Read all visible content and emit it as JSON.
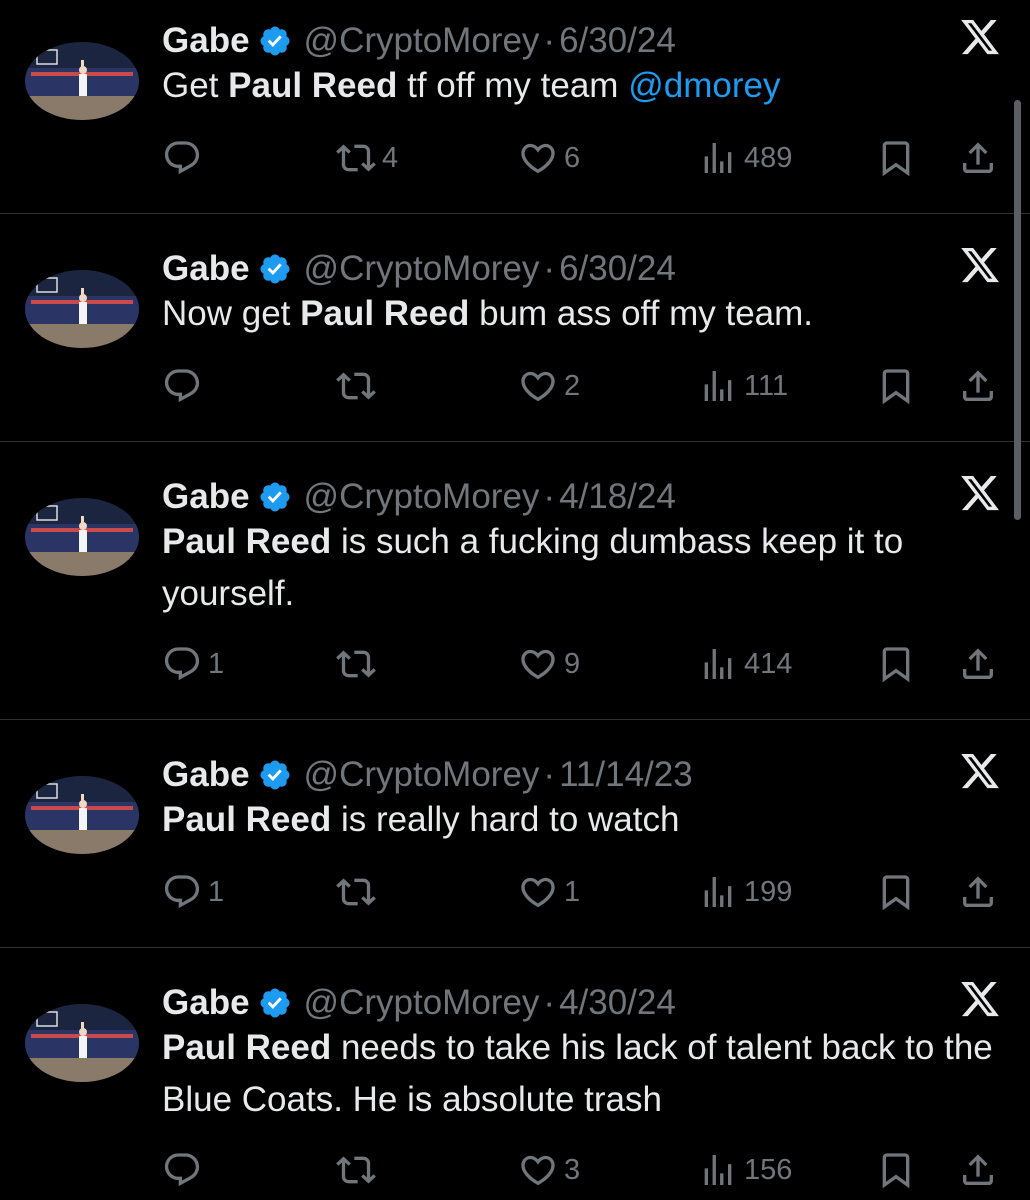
{
  "tweets": [
    {
      "name": "Gabe",
      "handle": "@CryptoMorey",
      "separator": "·",
      "date": "6/30/24",
      "text_parts": [
        {
          "t": "Get ",
          "s": "normal"
        },
        {
          "t": "Paul Reed",
          "s": "bold"
        },
        {
          "t": " tf off my team ",
          "s": "normal"
        },
        {
          "t": "@dmorey",
          "s": "mention"
        }
      ],
      "replies": "",
      "reposts": "4",
      "likes": "6",
      "views": "489"
    },
    {
      "name": "Gabe",
      "handle": "@CryptoMorey",
      "separator": "·",
      "date": "6/30/24",
      "text_parts": [
        {
          "t": "Now get ",
          "s": "normal"
        },
        {
          "t": "Paul Reed",
          "s": "bold"
        },
        {
          "t": " bum ass off my team.",
          "s": "normal"
        }
      ],
      "replies": "",
      "reposts": "",
      "likes": "2",
      "views": "111"
    },
    {
      "name": "Gabe",
      "handle": "@CryptoMorey",
      "separator": "·",
      "date": "4/18/24",
      "text_parts": [
        {
          "t": "Paul Reed",
          "s": "bold"
        },
        {
          "t": " is such a fucking dumbass keep it to yourself.",
          "s": "normal"
        }
      ],
      "replies": "1",
      "reposts": "",
      "likes": "9",
      "views": "414"
    },
    {
      "name": "Gabe",
      "handle": "@CryptoMorey",
      "separator": "·",
      "date": "11/14/23",
      "text_parts": [
        {
          "t": "Paul Reed",
          "s": "bold"
        },
        {
          "t": " is really hard to watch",
          "s": "normal"
        }
      ],
      "replies": "1",
      "reposts": "",
      "likes": "1",
      "views": "199"
    },
    {
      "name": "Gabe",
      "handle": "@CryptoMorey",
      "separator": "·",
      "date": "4/30/24",
      "text_parts": [
        {
          "t": "Paul Reed",
          "s": "bold"
        },
        {
          "t": " needs to take his lack of talent back to the Blue Coats. He is absolute trash",
          "s": "normal"
        }
      ],
      "replies": "",
      "reposts": "",
      "likes": "3",
      "views": "156"
    }
  ],
  "icons": {
    "verified": "verified-badge-icon",
    "platform": "x-logo-icon",
    "reply": "reply-icon",
    "repost": "repost-icon",
    "like": "heart-icon",
    "views": "views-icon",
    "bookmark": "bookmark-icon",
    "share": "share-icon"
  },
  "colors": {
    "background": "#000000",
    "text": "#e7e9ea",
    "muted": "#71767b",
    "mention": "#1d9bf0",
    "verified": "#1d9bf0",
    "divider": "#2f3336"
  }
}
